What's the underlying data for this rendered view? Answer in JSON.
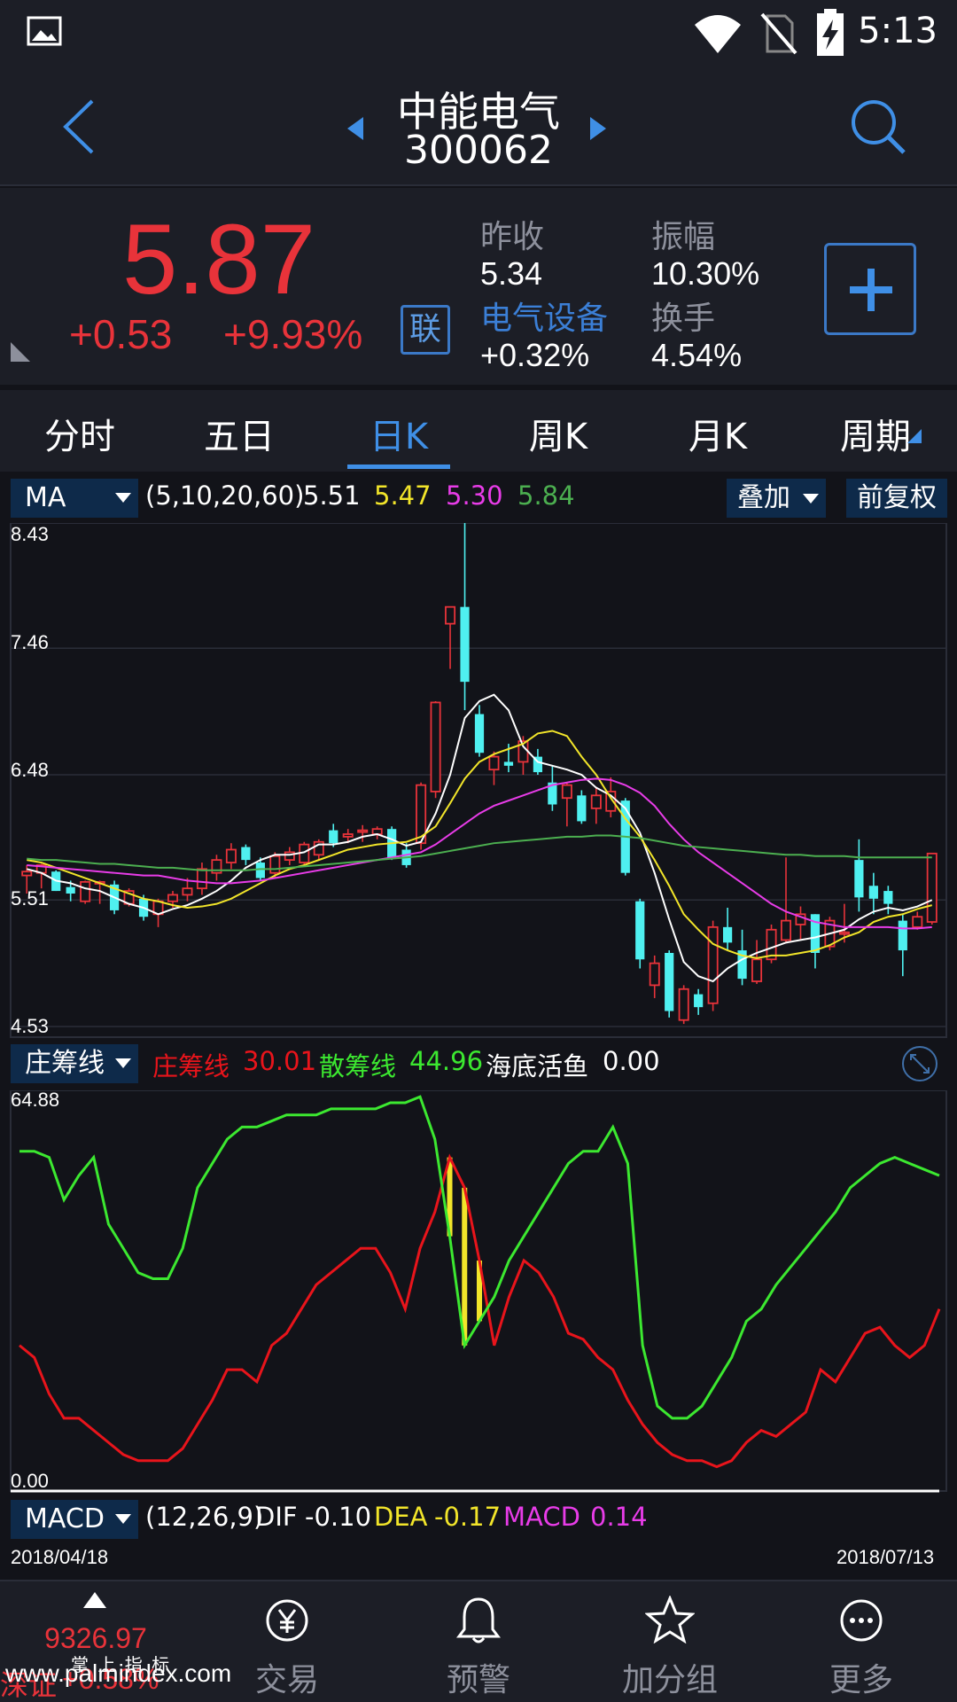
{
  "status_bar": {
    "time": "5:13"
  },
  "header": {
    "stock_name": "中能电气",
    "stock_code": "300062"
  },
  "quote": {
    "price": "5.87",
    "change": "+0.53",
    "change_pct": "+9.93%",
    "lian_label": "联",
    "prev_close_label": "昨收",
    "prev_close": "5.34",
    "amplitude_label": "振幅",
    "amplitude": "10.30%",
    "sector_label": "电气设备",
    "sector_change": "+0.32%",
    "turnover_label": "换手",
    "turnover": "4.54%"
  },
  "tabs": [
    "分时",
    "五日",
    "日K",
    "周K",
    "月K",
    "周期"
  ],
  "active_tab": "日K",
  "ma_bar": {
    "dropdown": "MA",
    "params": "(5,10,20,60)",
    "values": [
      "5.51",
      "5.47",
      "5.30",
      "5.84"
    ],
    "colors": [
      "#ffffff",
      "#f2e52a",
      "#e83ce8",
      "#4caf50"
    ],
    "overlay_button": "叠加",
    "adjust_button": "前复权"
  },
  "ind_bar": {
    "dropdown": "庄筹线",
    "name1": "庄筹线",
    "value1": "30.01",
    "name2": "散筹线",
    "value2": "44.96",
    "name3": "海底活鱼",
    "value3": "0.00"
  },
  "macd_bar": {
    "dropdown": "MACD",
    "params": "(12,26,9)",
    "dif_label": "DIF",
    "dif": "-0.10",
    "dea_label": "DEA",
    "dea": "-0.17",
    "macd_label": "MACD",
    "macd": "0.14"
  },
  "dates": {
    "start": "2018/04/18",
    "end": "2018/07/13"
  },
  "bottom_nav": {
    "index_value": "9326.97",
    "index_change": "+0.58%",
    "index_label": "深证",
    "items": [
      "交易",
      "预警",
      "加分组",
      "更多"
    ]
  },
  "watermark": {
    "line1": "掌 上 指 标",
    "line2": "www.palmindex.com"
  },
  "chart_data": [
    {
      "type": "candlestick",
      "y_ticks": [
        "8.43",
        "7.46",
        "6.48",
        "5.51",
        "4.53"
      ],
      "ylim": [
        4.53,
        8.43
      ],
      "candles": [
        {
          "o": 5.7,
          "h": 5.78,
          "l": 5.56,
          "c": 5.73
        },
        {
          "o": 5.72,
          "h": 5.79,
          "l": 5.6,
          "c": 5.78
        },
        {
          "o": 5.73,
          "h": 5.74,
          "l": 5.58,
          "c": 5.58
        },
        {
          "o": 5.61,
          "h": 5.66,
          "l": 5.5,
          "c": 5.56
        },
        {
          "o": 5.5,
          "h": 5.66,
          "l": 5.48,
          "c": 5.65
        },
        {
          "o": 5.64,
          "h": 5.66,
          "l": 5.48,
          "c": 5.65
        },
        {
          "o": 5.63,
          "h": 5.66,
          "l": 5.4,
          "c": 5.43
        },
        {
          "o": 5.48,
          "h": 5.6,
          "l": 5.46,
          "c": 5.58
        },
        {
          "o": 5.52,
          "h": 5.55,
          "l": 5.35,
          "c": 5.38
        },
        {
          "o": 5.4,
          "h": 5.52,
          "l": 5.3,
          "c": 5.5
        },
        {
          "o": 5.5,
          "h": 5.58,
          "l": 5.45,
          "c": 5.55
        },
        {
          "o": 5.55,
          "h": 5.68,
          "l": 5.5,
          "c": 5.6
        },
        {
          "o": 5.6,
          "h": 5.8,
          "l": 5.55,
          "c": 5.75
        },
        {
          "o": 5.72,
          "h": 5.86,
          "l": 5.66,
          "c": 5.82
        },
        {
          "o": 5.8,
          "h": 5.95,
          "l": 5.75,
          "c": 5.9
        },
        {
          "o": 5.92,
          "h": 5.94,
          "l": 5.78,
          "c": 5.82
        },
        {
          "o": 5.8,
          "h": 5.84,
          "l": 5.66,
          "c": 5.68
        },
        {
          "o": 5.72,
          "h": 5.88,
          "l": 5.68,
          "c": 5.85
        },
        {
          "o": 5.82,
          "h": 5.92,
          "l": 5.78,
          "c": 5.88
        },
        {
          "o": 5.8,
          "h": 5.96,
          "l": 5.78,
          "c": 5.94
        },
        {
          "o": 5.86,
          "h": 5.98,
          "l": 5.82,
          "c": 5.96
        },
        {
          "o": 6.05,
          "h": 6.1,
          "l": 5.92,
          "c": 5.95
        },
        {
          "o": 6.0,
          "h": 6.06,
          "l": 5.95,
          "c": 6.02
        },
        {
          "o": 6.04,
          "h": 6.09,
          "l": 5.96,
          "c": 6.05
        },
        {
          "o": 6.02,
          "h": 6.08,
          "l": 5.98,
          "c": 6.06
        },
        {
          "o": 6.06,
          "h": 6.08,
          "l": 5.82,
          "c": 5.84
        },
        {
          "o": 5.9,
          "h": 5.95,
          "l": 5.76,
          "c": 5.78
        },
        {
          "o": 5.95,
          "h": 6.42,
          "l": 5.9,
          "c": 6.4
        },
        {
          "o": 6.35,
          "h": 7.05,
          "l": 6.3,
          "c": 7.04
        },
        {
          "o": 7.65,
          "h": 7.78,
          "l": 7.3,
          "c": 7.78
        },
        {
          "o": 7.78,
          "h": 8.43,
          "l": 6.98,
          "c": 7.2
        },
        {
          "o": 6.95,
          "h": 7.02,
          "l": 6.62,
          "c": 6.65
        },
        {
          "o": 6.52,
          "h": 6.66,
          "l": 6.4,
          "c": 6.62
        },
        {
          "o": 6.58,
          "h": 6.72,
          "l": 6.5,
          "c": 6.55
        },
        {
          "o": 6.58,
          "h": 6.78,
          "l": 6.48,
          "c": 6.74
        },
        {
          "o": 6.62,
          "h": 6.68,
          "l": 6.48,
          "c": 6.5
        },
        {
          "o": 6.42,
          "h": 6.55,
          "l": 6.2,
          "c": 6.25
        },
        {
          "o": 6.3,
          "h": 6.42,
          "l": 6.08,
          "c": 6.4
        },
        {
          "o": 6.32,
          "h": 6.36,
          "l": 6.1,
          "c": 6.12
        },
        {
          "o": 6.22,
          "h": 6.38,
          "l": 6.1,
          "c": 6.32
        },
        {
          "o": 6.2,
          "h": 6.46,
          "l": 6.15,
          "c": 6.35
        },
        {
          "o": 6.28,
          "h": 6.3,
          "l": 5.7,
          "c": 5.72
        },
        {
          "o": 5.5,
          "h": 5.52,
          "l": 4.98,
          "c": 5.05
        },
        {
          "o": 4.85,
          "h": 5.08,
          "l": 4.75,
          "c": 5.02
        },
        {
          "o": 5.1,
          "h": 5.12,
          "l": 4.6,
          "c": 4.65
        },
        {
          "o": 4.58,
          "h": 4.85,
          "l": 4.55,
          "c": 4.82
        },
        {
          "o": 4.78,
          "h": 4.82,
          "l": 4.62,
          "c": 4.68
        },
        {
          "o": 4.71,
          "h": 5.35,
          "l": 4.65,
          "c": 5.3
        },
        {
          "o": 5.3,
          "h": 5.45,
          "l": 5.12,
          "c": 5.18
        },
        {
          "o": 5.12,
          "h": 5.28,
          "l": 4.85,
          "c": 4.9
        },
        {
          "o": 4.88,
          "h": 5.2,
          "l": 4.86,
          "c": 5.05
        },
        {
          "o": 5.05,
          "h": 5.32,
          "l": 5.02,
          "c": 5.28
        },
        {
          "o": 5.2,
          "h": 5.84,
          "l": 5.18,
          "c": 5.35
        },
        {
          "o": 5.32,
          "h": 5.46,
          "l": 5.2,
          "c": 5.4
        },
        {
          "o": 5.4,
          "h": 5.35,
          "l": 4.98,
          "c": 5.1
        },
        {
          "o": 5.15,
          "h": 5.38,
          "l": 5.12,
          "c": 5.35
        },
        {
          "o": 5.25,
          "h": 5.48,
          "l": 5.18,
          "c": 5.26
        },
        {
          "o": 5.82,
          "h": 5.98,
          "l": 5.42,
          "c": 5.53
        },
        {
          "o": 5.62,
          "h": 5.72,
          "l": 5.4,
          "c": 5.52
        },
        {
          "o": 5.58,
          "h": 5.62,
          "l": 5.4,
          "c": 5.48
        },
        {
          "o": 5.35,
          "h": 5.4,
          "l": 4.92,
          "c": 5.12
        },
        {
          "o": 5.3,
          "h": 5.42,
          "l": 5.28,
          "c": 5.38
        },
        {
          "o": 5.34,
          "h": 5.87,
          "l": 5.32,
          "c": 5.87
        }
      ],
      "ma5": [
        5.75,
        5.72,
        5.66,
        5.64,
        5.6,
        5.58,
        5.53,
        5.48,
        5.45,
        5.4,
        5.44,
        5.47,
        5.52,
        5.58,
        5.66,
        5.76,
        5.82,
        5.86,
        5.86,
        5.88,
        5.94,
        5.94,
        5.96,
        6.0,
        6.02,
        5.98,
        5.93,
        5.96,
        6.18,
        6.48,
        6.92,
        7.05,
        7.1,
        6.98,
        6.7,
        6.58,
        6.55,
        6.52,
        6.48,
        6.38,
        6.32,
        6.22,
        6.03,
        5.72,
        5.36,
        5.03,
        4.92,
        4.88,
        4.98,
        5.05,
        5.1,
        5.14,
        5.18,
        5.2,
        5.22,
        5.25,
        5.28,
        5.36,
        5.42,
        5.45,
        5.43,
        5.46,
        5.51
      ],
      "ma10": [
        5.82,
        5.8,
        5.76,
        5.72,
        5.68,
        5.64,
        5.6,
        5.56,
        5.52,
        5.5,
        5.47,
        5.45,
        5.46,
        5.48,
        5.52,
        5.58,
        5.64,
        5.7,
        5.75,
        5.78,
        5.82,
        5.86,
        5.9,
        5.92,
        5.94,
        5.95,
        5.96,
        6.0,
        6.08,
        6.26,
        6.45,
        6.58,
        6.64,
        6.68,
        6.72,
        6.8,
        6.82,
        6.78,
        6.62,
        6.48,
        6.3,
        6.14,
        6.0,
        5.82,
        5.62,
        5.4,
        5.28,
        5.17,
        5.12,
        5.08,
        5.06,
        5.08,
        5.08,
        5.1,
        5.12,
        5.16,
        5.22,
        5.26,
        5.34,
        5.38,
        5.4,
        5.44,
        5.47
      ],
      "ma20": [
        5.78,
        5.77,
        5.76,
        5.75,
        5.74,
        5.73,
        5.72,
        5.71,
        5.7,
        5.7,
        5.68,
        5.66,
        5.65,
        5.64,
        5.64,
        5.65,
        5.66,
        5.68,
        5.7,
        5.72,
        5.74,
        5.76,
        5.78,
        5.8,
        5.82,
        5.84,
        5.86,
        5.88,
        5.94,
        6.02,
        6.1,
        6.18,
        6.24,
        6.28,
        6.32,
        6.36,
        6.4,
        6.42,
        6.44,
        6.45,
        6.44,
        6.4,
        6.34,
        6.24,
        6.1,
        5.98,
        5.88,
        5.8,
        5.72,
        5.64,
        5.56,
        5.48,
        5.42,
        5.38,
        5.34,
        5.32,
        5.3,
        5.3,
        5.3,
        5.3,
        5.29,
        5.29,
        5.3
      ],
      "ma60": [
        5.83,
        5.82,
        5.82,
        5.81,
        5.8,
        5.79,
        5.79,
        5.78,
        5.77,
        5.76,
        5.76,
        5.75,
        5.74,
        5.74,
        5.74,
        5.74,
        5.75,
        5.75,
        5.76,
        5.77,
        5.78,
        5.79,
        5.8,
        5.81,
        5.82,
        5.83,
        5.84,
        5.85,
        5.87,
        5.89,
        5.91,
        5.93,
        5.95,
        5.96,
        5.97,
        5.98,
        5.99,
        6.0,
        6.0,
        6.01,
        6.01,
        6.0,
        5.99,
        5.97,
        5.95,
        5.93,
        5.92,
        5.91,
        5.9,
        5.89,
        5.88,
        5.87,
        5.86,
        5.86,
        5.85,
        5.85,
        5.85,
        5.84,
        5.84,
        5.84,
        5.84,
        5.84,
        5.84
      ]
    },
    {
      "type": "line",
      "y_ticks": [
        "64.88",
        "0.00"
      ],
      "ylim": [
        0,
        64.88
      ],
      "series": [
        {
          "name": "庄筹线",
          "color": "#e8141b",
          "values": [
            24,
            22,
            16,
            12,
            12,
            10,
            8,
            6,
            5,
            5,
            5,
            7,
            11,
            15,
            20,
            20,
            18,
            24,
            26,
            30,
            34,
            36,
            38,
            40,
            40,
            36,
            30,
            40,
            46,
            55,
            50,
            38,
            24,
            32,
            38,
            36,
            32,
            26,
            25,
            22,
            20,
            15,
            11,
            8,
            6,
            5,
            5,
            4,
            5,
            8,
            10,
            9,
            11,
            13,
            20,
            18,
            22,
            26,
            27,
            24,
            22,
            24,
            30
          ]
        },
        {
          "name": "散筹线",
          "color": "#3ce830",
          "values": [
            56,
            56,
            55,
            48,
            52,
            55,
            44,
            40,
            36,
            35,
            35,
            40,
            50,
            54,
            58,
            60,
            60,
            61,
            62,
            62,
            62,
            63,
            63,
            63,
            63,
            64,
            64,
            65,
            58,
            42,
            24,
            28,
            32,
            38,
            42,
            46,
            50,
            54,
            56,
            56,
            60,
            54,
            24,
            14,
            12,
            12,
            14,
            18,
            22,
            28,
            30,
            34,
            37,
            40,
            43,
            46,
            50,
            52,
            54,
            55,
            54,
            53,
            52
          ]
        }
      ]
    }
  ]
}
